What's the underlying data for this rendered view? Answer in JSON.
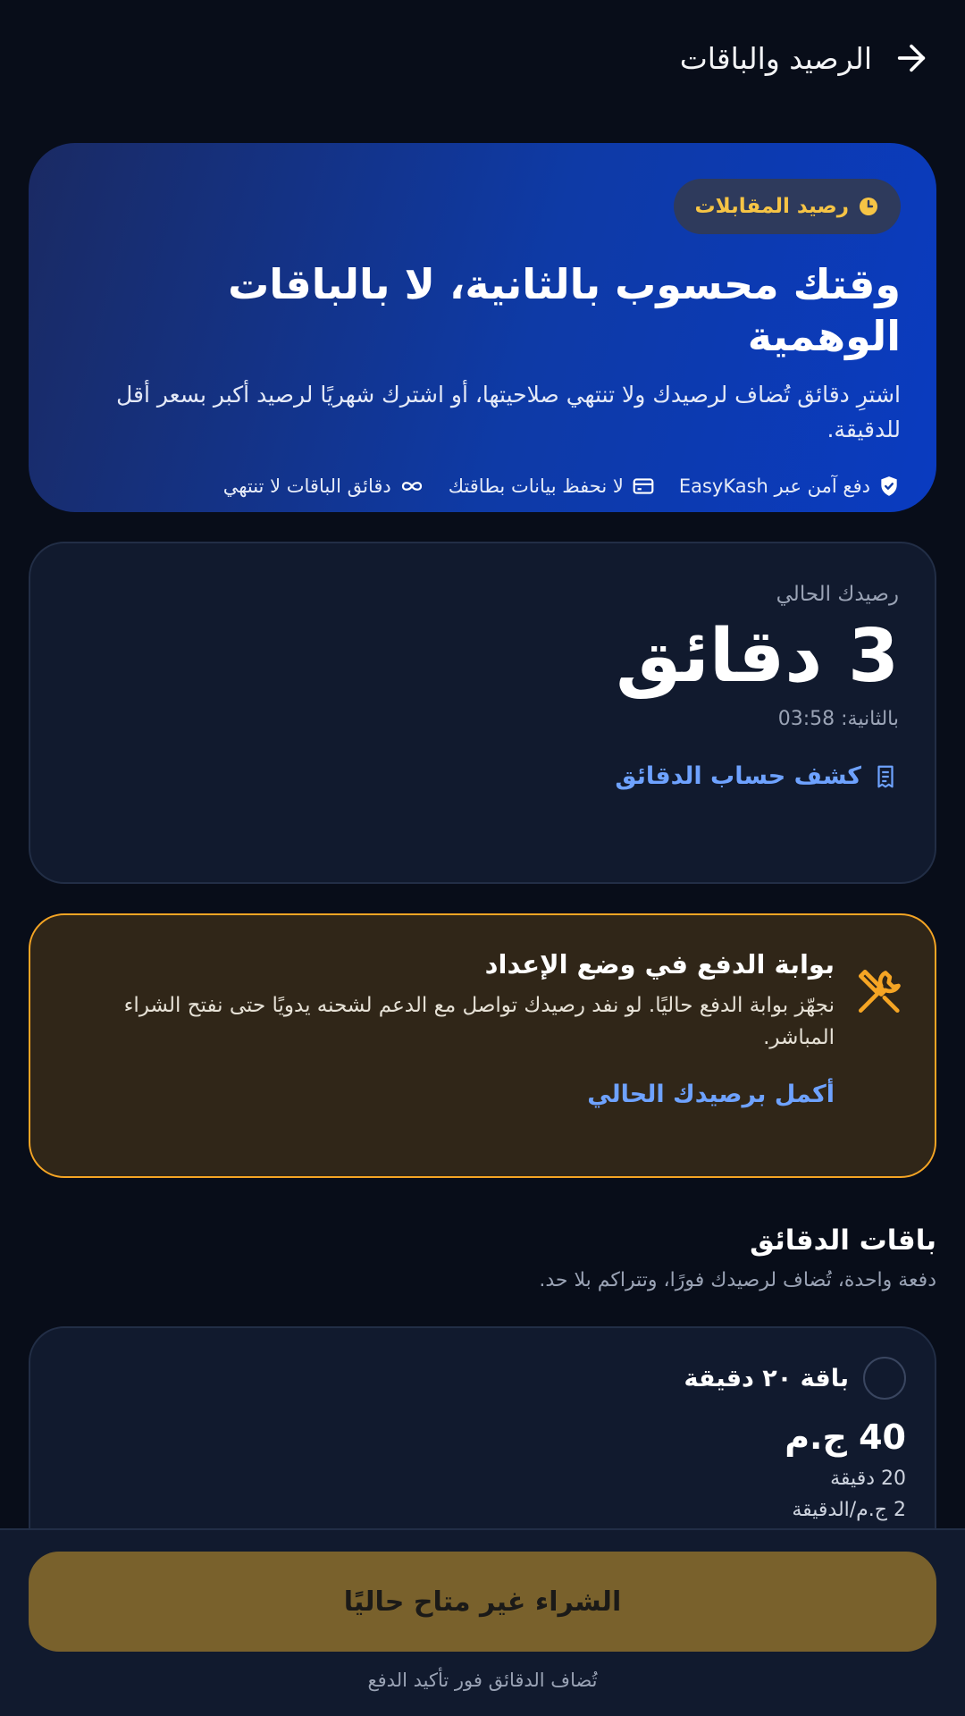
{
  "header": {
    "title": "الرصيد والباقات",
    "back_icon": "arrow-right-icon"
  },
  "hero": {
    "chip_label": "رصيد المقابلات",
    "chip_icon": "clock-icon",
    "title": "وقتك محسوب بالثانية، لا بالباقات الوهمية",
    "description": "اشترِ دقائق تُضاف لرصيدك ولا تنتهي صلاحيتها، أو اشترك شهريًا لرصيد أكبر بسعر أقل للدقيقة.",
    "features": [
      {
        "icon": "shield-check-icon",
        "label": "دفع آمن عبر EasyKash"
      },
      {
        "icon": "credit-card-icon",
        "label": "لا نحفظ بيانات بطاقتك"
      },
      {
        "icon": "infinity-icon",
        "label": "دقائق الباقات لا تنتهي"
      }
    ]
  },
  "balance": {
    "label": "رصيدك الحالي",
    "value": "3 دقائق",
    "seconds": "بالثانية: 03:58",
    "statement_link": "كشف حساب الدقائق",
    "statement_icon": "receipt-icon"
  },
  "warning": {
    "icon": "tools-icon",
    "title": "بوابة الدفع في وضع الإعداد",
    "description": "نجهّز بوابة الدفع حاليًا. لو نفد رصيدك تواصل مع الدعم لشحنه يدويًا حتى نفتح الشراء المباشر.",
    "action": "أكمل برصيدك الحالي"
  },
  "packages": {
    "title": "باقات الدقائق",
    "subtitle": "دفعة واحدة، تُضاف لرصيدك فورًا، وتتراكم بلا حد.",
    "items": [
      {
        "name": "باقة ٢٠ دقيقة",
        "price": "40 ج.م",
        "minutes": "20 دقيقة",
        "rate": "2 ج.م/الدقيقة"
      }
    ]
  },
  "footer": {
    "buy_label": "الشراء غير متاح حاليًا",
    "note": "تُضاف الدقائق فور تأكيد الدفع"
  },
  "colors": {
    "background": "#080d19",
    "card": "#111a2e",
    "accent_blue": "#6ea2ff",
    "accent_yellow": "#f6c445",
    "warning_border": "#f5a524",
    "button_disabled": "#79612c"
  }
}
